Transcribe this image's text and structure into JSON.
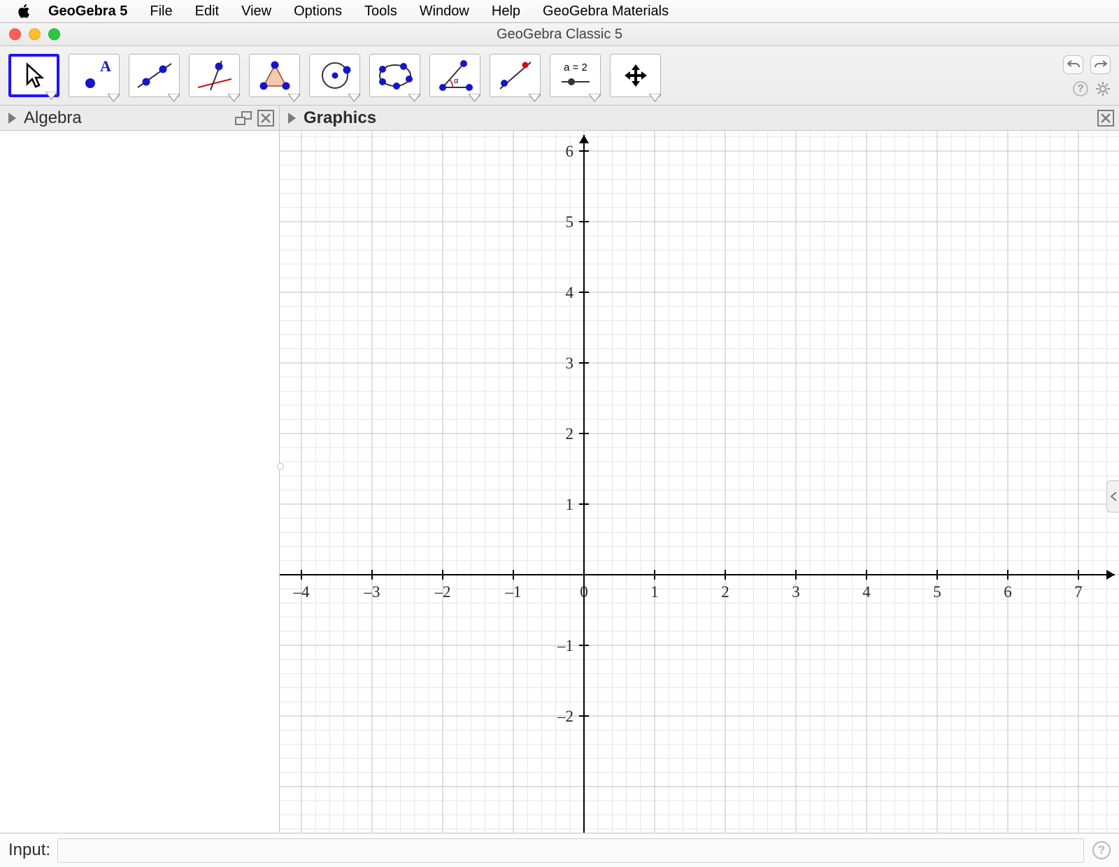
{
  "menubar": {
    "app_name": "GeoGebra 5",
    "items": [
      "File",
      "Edit",
      "View",
      "Options",
      "Tools",
      "Window",
      "Help",
      "GeoGebra Materials"
    ]
  },
  "window": {
    "title": "GeoGebra Classic 5"
  },
  "toolbar": {
    "tools": [
      {
        "name": "move-tool",
        "selected": true
      },
      {
        "name": "point-tool"
      },
      {
        "name": "line-tool"
      },
      {
        "name": "perpendicular-tool"
      },
      {
        "name": "polygon-tool"
      },
      {
        "name": "circle-tool"
      },
      {
        "name": "conic-tool"
      },
      {
        "name": "angle-tool"
      },
      {
        "name": "reflect-tool"
      },
      {
        "name": "slider-tool",
        "label": "a = 2"
      },
      {
        "name": "move-view-tool"
      }
    ]
  },
  "panels": {
    "algebra": {
      "title": "Algebra"
    },
    "graphics": {
      "title": "Graphics"
    }
  },
  "input": {
    "label": "Input:",
    "value": ""
  },
  "chart_data": {
    "type": "scatter",
    "title": "",
    "xlabel": "",
    "ylabel": "",
    "xlim": [
      -4,
      7
    ],
    "ylim": [
      -2,
      6
    ],
    "xticks": [
      -4,
      -3,
      -2,
      -1,
      0,
      1,
      2,
      3,
      4,
      5,
      6,
      7
    ],
    "yticks": [
      -2,
      -1,
      1,
      2,
      3,
      4,
      5,
      6
    ],
    "minor_grid_div": 5,
    "series": []
  }
}
